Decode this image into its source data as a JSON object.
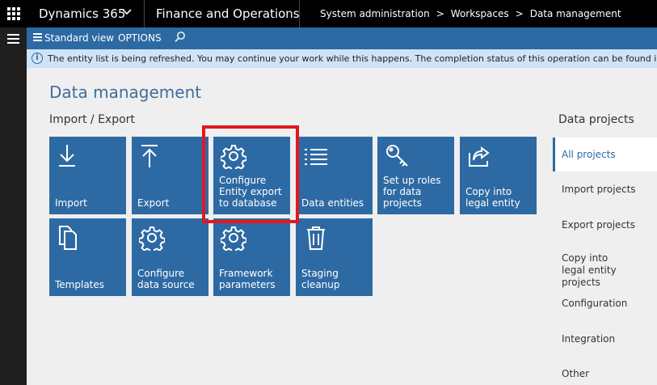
{
  "topbar": {
    "app_name": "Dynamics 365",
    "module_name": "Finance and Operations",
    "breadcrumb": [
      "System administration",
      "Workspaces",
      "Data management"
    ],
    "crumb_separator": ">"
  },
  "actionbar": {
    "view_label": "Standard view",
    "options_label": "OPTIONS"
  },
  "infobar": {
    "icon_glyph": "i",
    "message": "The entity list is being refreshed. You may continue your work while this happens. The completion status of this operation can be found in the message cent"
  },
  "main": {
    "title": "Data management",
    "section": "Import / Export",
    "tiles": [
      {
        "label": "Import",
        "icon": "download-arrow-icon"
      },
      {
        "label": "Export",
        "icon": "upload-arrow-icon"
      },
      {
        "label": "Configure Entity export to database",
        "icon": "gear-icon"
      },
      {
        "label": "Data entities",
        "icon": "list-icon"
      },
      {
        "label": "Set up roles for data projects",
        "icon": "key-icon"
      },
      {
        "label": "Copy into legal entity",
        "icon": "share-icon"
      },
      {
        "label": "Templates",
        "icon": "documents-icon"
      },
      {
        "label": "Configure data source",
        "icon": "gear-icon"
      },
      {
        "label": "Framework parameters",
        "icon": "gear-icon"
      },
      {
        "label": "Staging cleanup",
        "icon": "trash-icon"
      }
    ]
  },
  "rightpanel": {
    "title": "Data projects",
    "items": [
      "All projects",
      "Import projects",
      "Export projects",
      "Copy into legal entity projects",
      "Configuration",
      "Integration",
      "Other"
    ],
    "active_index": 0
  },
  "colors": {
    "accent": "#2d6aa4",
    "highlight": "#e0191f",
    "topbar": "#000000",
    "infobar": "#cfe3f5"
  }
}
